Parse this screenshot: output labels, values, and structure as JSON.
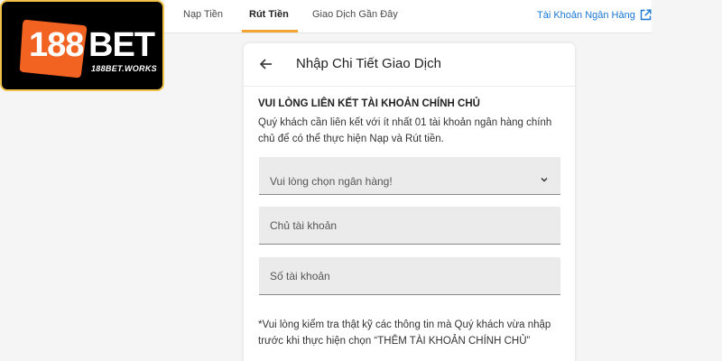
{
  "logo": {
    "number": "188",
    "brand": "BET",
    "domain": "188BET.WORKS",
    "colors": {
      "badge": "#f26322",
      "border": "#f0c24a",
      "background": "#000000"
    }
  },
  "nav": {
    "tabs": [
      {
        "label": "Nạp Tiền",
        "active": false
      },
      {
        "label": "Rút Tiền",
        "active": true
      },
      {
        "label": "Giao Dịch Gần Đây",
        "active": false
      }
    ],
    "bank_link": {
      "label": "Tài Khoản Ngân Hàng",
      "icon": "external-link-icon"
    },
    "accent_color": "#f4a531",
    "link_color": "#1976d2"
  },
  "card": {
    "title": "Nhập Chi Tiết Giao Dịch",
    "back_icon": "arrow-left-icon",
    "heading": "VUI LÒNG LIÊN KẾT TÀI KHOẢN CHÍNH CHỦ",
    "description": "Quý khách cần liên kết với ít nhất 01 tài khoản ngân hàng chính chủ để có thể thực hiện Nạp và Rút tiền.",
    "bank_select": {
      "value": "Vui lòng chọn ngân hàng!",
      "icon": "chevron-down-icon"
    },
    "account_holder": {
      "placeholder": "Chủ tài khoản",
      "value": ""
    },
    "account_number": {
      "placeholder": "Số tài khoản",
      "value": ""
    },
    "note": "*Vui lòng kiểm tra thật kỹ các thông tin mà Quý khách vừa nhập trước khi thực hiện chọn “THÊM TÀI KHOẢN CHÍNH CHỦ”"
  }
}
